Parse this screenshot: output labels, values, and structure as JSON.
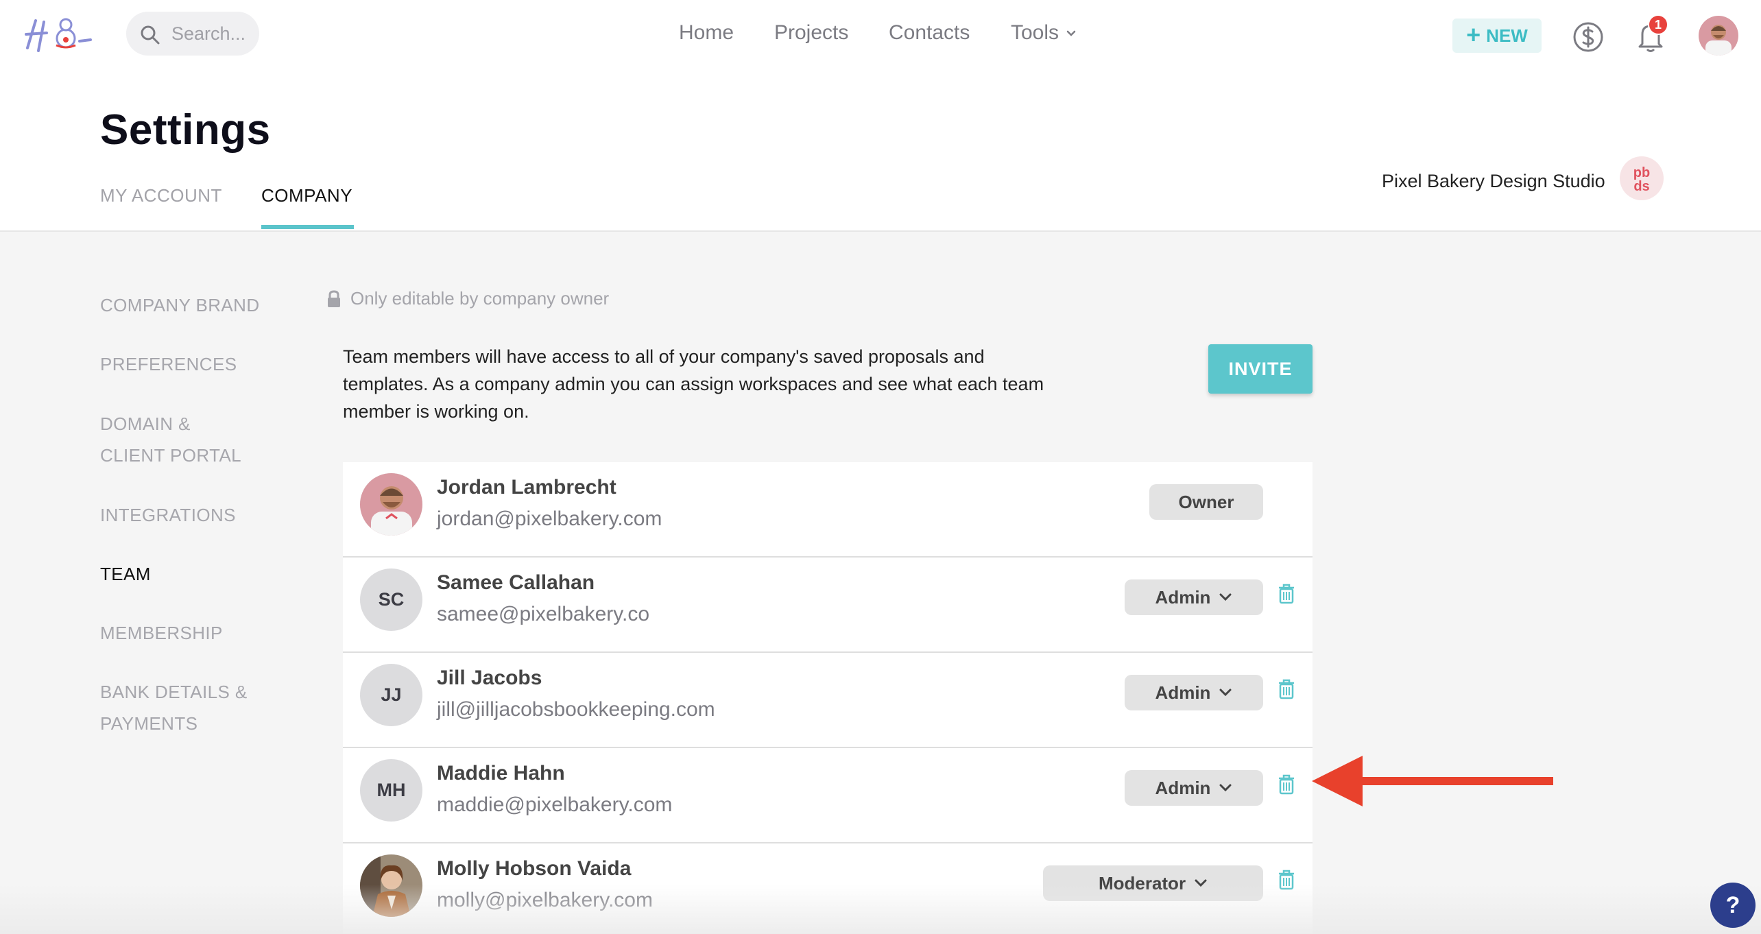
{
  "nav": {
    "search_placeholder": "Search...",
    "links": [
      "Home",
      "Projects",
      "Contacts",
      "Tools"
    ],
    "new_label": "NEW",
    "notification_count": "1"
  },
  "header": {
    "title": "Settings",
    "tabs": [
      "MY ACCOUNT",
      "COMPANY"
    ],
    "active_tab": "COMPANY",
    "company_name": "Pixel Bakery Design Studio",
    "company_logo_text": "pb ds"
  },
  "sidebar": {
    "items": [
      {
        "line1": "COMPANY BRAND",
        "line2": ""
      },
      {
        "line1": "PREFERENCES",
        "line2": ""
      },
      {
        "line1": "DOMAIN &",
        "line2": "CLIENT PORTAL"
      },
      {
        "line1": "INTEGRATIONS",
        "line2": ""
      },
      {
        "line1": "TEAM",
        "line2": ""
      },
      {
        "line1": "MEMBERSHIP",
        "line2": ""
      },
      {
        "line1": "BANK DETAILS &",
        "line2": "PAYMENTS"
      }
    ],
    "active": "TEAM"
  },
  "main": {
    "lock_note": "Only editable by company owner",
    "intro_text": "Team members will have access to all of your company's saved proposals and templates. As a company admin you can assign workspaces and see what each team member is working on.",
    "invite_label": "INVITE",
    "members": [
      {
        "name": "Jordan Lambrecht",
        "email": "jordan@pixelbakery.com",
        "role": "Owner",
        "initials": "",
        "avatar": "photo"
      },
      {
        "name": "Samee Callahan",
        "email": "samee@pixelbakery.co",
        "role": "Admin",
        "initials": "SC",
        "avatar": "initials"
      },
      {
        "name": "Jill Jacobs",
        "email": "jill@jilljacobsbookkeeping.com",
        "role": "Admin",
        "initials": "JJ",
        "avatar": "initials"
      },
      {
        "name": "Maddie Hahn",
        "email": "maddie@pixelbakery.com",
        "role": "Admin",
        "initials": "MH",
        "avatar": "initials"
      },
      {
        "name": "Molly Hobson Vaida",
        "email": "molly@pixelbakery.com",
        "role": "Moderator",
        "initials": "",
        "avatar": "photo"
      }
    ]
  },
  "help_label": "?",
  "colors": {
    "accent": "#5cc6cc",
    "annotation_arrow": "#e8412c",
    "help_button": "#2c3e8c",
    "badge": "#e8413c"
  }
}
